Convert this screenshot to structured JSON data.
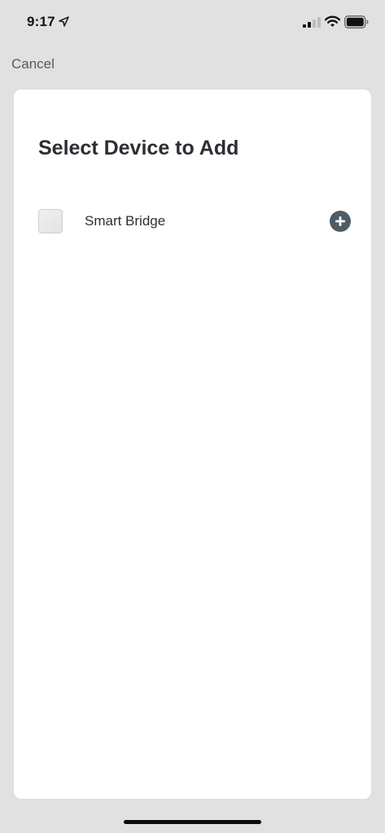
{
  "status_bar": {
    "time": "9:17",
    "icons": [
      "location-arrow-icon",
      "cellular-signal-icon",
      "wifi-icon",
      "battery-icon"
    ]
  },
  "nav": {
    "cancel_label": "Cancel"
  },
  "sheet": {
    "title": "Select Device to Add",
    "devices": [
      {
        "name": "Smart Bridge",
        "thumbnail_icon": "smart-bridge-device-icon",
        "action_icon": "plus-circle-icon"
      }
    ]
  },
  "colors": {
    "background": "#e1e1e1",
    "sheet": "#ffffff",
    "text_primary": "#2b2f33",
    "text_secondary": "#555a5f",
    "accent_add": "#4e5c66"
  }
}
